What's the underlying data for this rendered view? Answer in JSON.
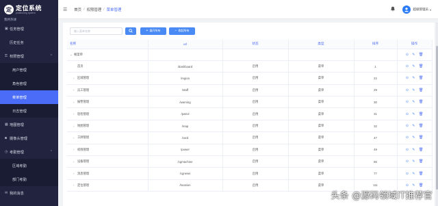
{
  "app": {
    "logo_mark": "定",
    "title": "定位系统",
    "subtitle": "positioning system",
    "brand_text": "我终热球"
  },
  "sidebar": {
    "items": [
      {
        "label": "任务管理",
        "icon": "task-icon"
      },
      {
        "label": "历史任务",
        "icon": "history-icon"
      },
      {
        "label": "权限管理",
        "icon": "lock-icon",
        "arrow": "⌃"
      },
      {
        "label": "用户管理"
      },
      {
        "label": "角色管理"
      },
      {
        "label": "菜单管理"
      },
      {
        "label": "日志管理"
      },
      {
        "label": "地图管理",
        "icon": "map-icon"
      },
      {
        "label": "摄像头管理",
        "icon": "camera-icon"
      },
      {
        "label": "考勤管理",
        "icon": "attendance-icon",
        "arrow": "⌃"
      },
      {
        "label": "区域考勤"
      },
      {
        "label": "部门考勤"
      },
      {
        "label": "我的消息",
        "icon": "message-icon"
      }
    ]
  },
  "header": {
    "collapse_icon": "☰",
    "breadcrumb": [
      "首页",
      "权限管理",
      "菜单管理"
    ],
    "bell_icon": "🔔",
    "avatar_glyph": "👤",
    "user_name": "超级管理员",
    "caret": "▾"
  },
  "toolbar": {
    "search_placeholder": "输入菜单名称",
    "search_button": "⌕",
    "expand_label": "展开所有",
    "collapse_label": "收起所有"
  },
  "table": {
    "columns": [
      "名称",
      "url",
      "状态",
      "类型",
      "排序",
      "操作"
    ],
    "rows": [
      {
        "name": "根菜单",
        "url": "",
        "status": "",
        "type": "",
        "sort": "",
        "level": 0,
        "arrow": "⌄",
        "ops": true
      },
      {
        "name": "首页",
        "url": "/dashboard",
        "status": "启用",
        "type": "菜单",
        "sort": "1",
        "level": "leaf",
        "arrow": "",
        "ops": true
      },
      {
        "name": "区域管理",
        "url": "/region",
        "status": "启用",
        "type": "菜单",
        "sort": "22",
        "level": 1,
        "arrow": "›",
        "ops": true
      },
      {
        "name": "员工管理",
        "url": "/staff",
        "status": "启用",
        "type": "菜单",
        "sort": "29",
        "level": 1,
        "arrow": "›",
        "ops": true
      },
      {
        "name": "报警管理",
        "url": "/warning",
        "status": "启用",
        "type": "菜单",
        "sort": "30",
        "level": 1,
        "arrow": "›",
        "ops": true
      },
      {
        "name": "巡检管理",
        "url": "/patrol",
        "status": "启用",
        "type": "菜单",
        "sort": "31",
        "level": 1,
        "arrow": "›",
        "ops": true
      },
      {
        "name": "地图管理",
        "url": "/map",
        "status": "启用",
        "type": "菜单",
        "sort": "32",
        "level": 1,
        "arrow": "›",
        "ops": true
      },
      {
        "name": "工牌管理",
        "url": "/card",
        "status": "启用",
        "type": "菜单",
        "sort": "47",
        "level": 1,
        "arrow": "›",
        "ops": true
      },
      {
        "name": "权限管理",
        "url": "/power",
        "status": "启用",
        "type": "菜单",
        "sort": "49",
        "level": 1,
        "arrow": "›",
        "ops": true
      },
      {
        "name": "设备管理",
        "url": "/cgmachine",
        "status": "启用",
        "type": "菜单",
        "sort": "66",
        "level": 1,
        "arrow": "›",
        "ops": true
      },
      {
        "name": "消息管理",
        "url": "/cgnews",
        "status": "启用",
        "type": "菜单",
        "sort": "77",
        "level": 1,
        "arrow": "›",
        "ops": true
      },
      {
        "name": "定位管理",
        "url": "/location",
        "status": "启用",
        "type": "菜单",
        "sort": "111",
        "level": 1,
        "arrow": "›",
        "ops": true
      }
    ]
  },
  "watermark": "头条 @源码领域IT推荐官",
  "colors": {
    "sidebar_bg": "#22243f",
    "accent": "#4a6cf7",
    "button": "#4a8af4"
  }
}
